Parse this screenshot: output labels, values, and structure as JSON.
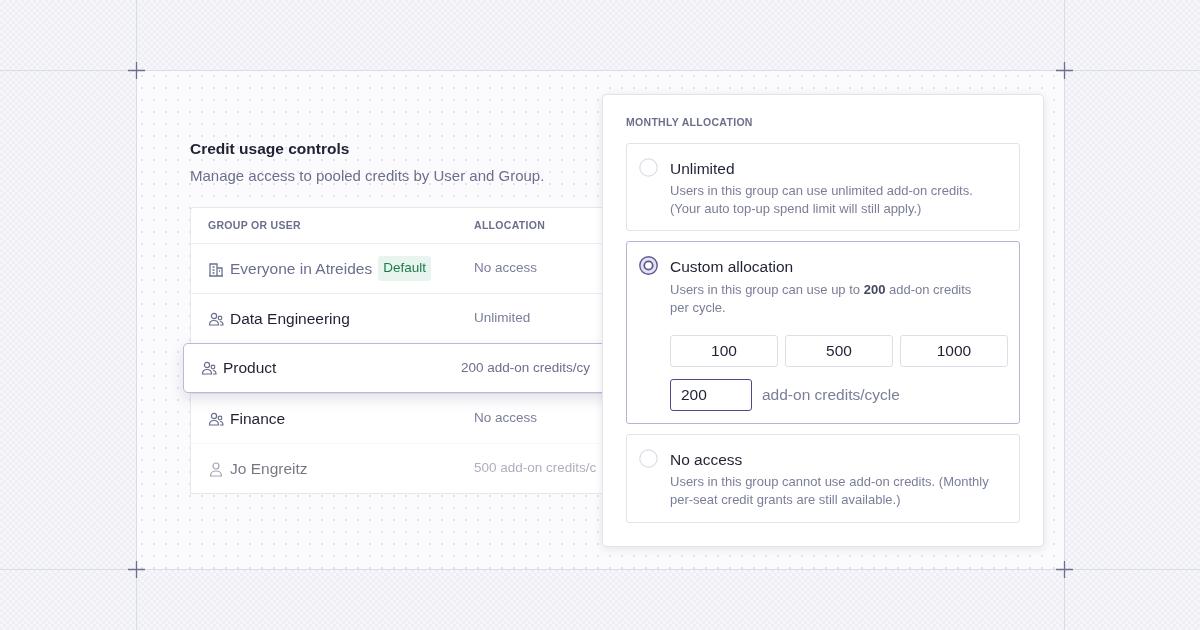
{
  "panel": {
    "title": "Credit usage controls",
    "subtitle": "Manage access to pooled credits by User and Group."
  },
  "table": {
    "columns": [
      "GROUP OR USER",
      "ALLOCATION"
    ],
    "rows": [
      {
        "kind": "organization",
        "name": "Everyone in Atreides",
        "badge": "Default",
        "allocation": "No access",
        "selected": false
      },
      {
        "kind": "group",
        "name": "Data Engineering",
        "allocation": "Unlimited",
        "selected": false
      },
      {
        "kind": "group",
        "name": "Product",
        "allocation": "200 add-on credits/cy",
        "selected": true
      },
      {
        "kind": "group",
        "name": "Finance",
        "allocation": "No access",
        "selected": false
      },
      {
        "kind": "user",
        "name": "Jo Engreitz",
        "allocation": "500 add-on credits/c",
        "selected": false
      }
    ]
  },
  "popover": {
    "heading": "MONTHLY ALLOCATION",
    "options": [
      {
        "label": "Unlimited",
        "description": "Users in this group can use unlimited add-on credits. (Your auto top-up spend limit will still apply.)",
        "selected": false
      },
      {
        "label": "Custom allocation",
        "description": "Users in this group can use up to **200** add-on credits per cycle.",
        "selected": true,
        "presets": [
          "100",
          "500",
          "1000"
        ],
        "value": "200",
        "unit": "add-on credits/cycle"
      },
      {
        "label": "No access",
        "description": "Users in this group cannot use add-on credits. (Monthly per-seat credit grants are still available.)",
        "selected": false
      }
    ]
  }
}
